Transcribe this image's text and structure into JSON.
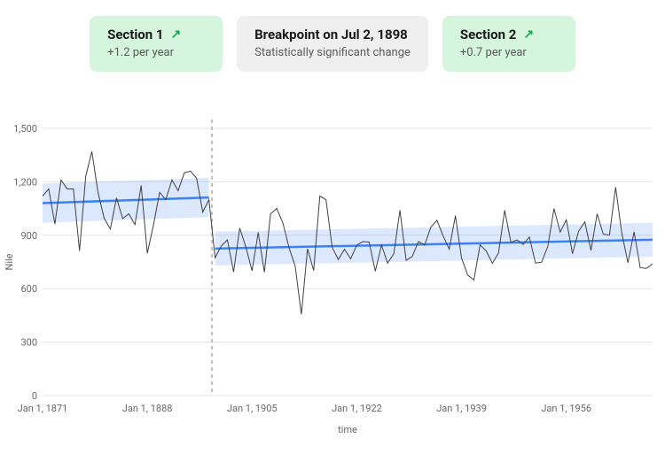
{
  "cards": {
    "section1": {
      "title": "Section 1",
      "arrow": "↗",
      "sub": "+1.2 per year"
    },
    "breakpoint": {
      "title": "Breakpoint on Jul 2, 1898",
      "sub": "Statistically significant change"
    },
    "section2": {
      "title": "Section 2",
      "arrow": "↗",
      "sub": "+0.7 per year"
    }
  },
  "chart_data": {
    "type": "line",
    "xlabel": "time",
    "ylabel": "Nile",
    "ylim": [
      0,
      1500
    ],
    "y_ticks": [
      0,
      300,
      600,
      900,
      1200,
      1500
    ],
    "x_ticks": [
      "Jan 1, 1871",
      "Jan 1, 1888",
      "Jan 1, 1905",
      "Jan 1, 1922",
      "Jan 1, 1939",
      "Jan 1, 1956"
    ],
    "x_range": [
      1871,
      1970
    ],
    "breakpoint_x": 1898.5,
    "series": [
      {
        "name": "Nile",
        "x_start": 1871,
        "values": [
          1120,
          1160,
          963,
          1210,
          1160,
          1160,
          813,
          1230,
          1370,
          1140,
          995,
          935,
          1110,
          994,
          1020,
          960,
          1180,
          799,
          958,
          1140,
          1100,
          1210,
          1150,
          1250,
          1260,
          1220,
          1030,
          1100,
          774,
          840,
          874,
          694,
          940,
          833,
          701,
          916,
          692,
          1020,
          1050,
          969,
          831,
          726,
          456,
          824,
          702,
          1120,
          1100,
          832,
          764,
          821,
          768,
          845,
          864,
          862,
          698,
          845,
          744,
          796,
          1040,
          759,
          781,
          865,
          845,
          944,
          984,
          897,
          822,
          1010,
          771,
          676,
          649,
          846,
          812,
          742,
          801,
          1040,
          860,
          874,
          848,
          890,
          744,
          749,
          838,
          1050,
          918,
          986,
          797,
          923,
          975,
          815,
          1020,
          906,
          901,
          1170,
          912,
          746,
          919,
          718,
          714,
          740
        ]
      }
    ],
    "trends": [
      {
        "x0": 1871,
        "y0": 1080,
        "x1": 1898,
        "y1": 1112,
        "band": 110
      },
      {
        "x0": 1899,
        "y0": 825,
        "x1": 1970,
        "y1": 875,
        "band": 95
      }
    ]
  }
}
